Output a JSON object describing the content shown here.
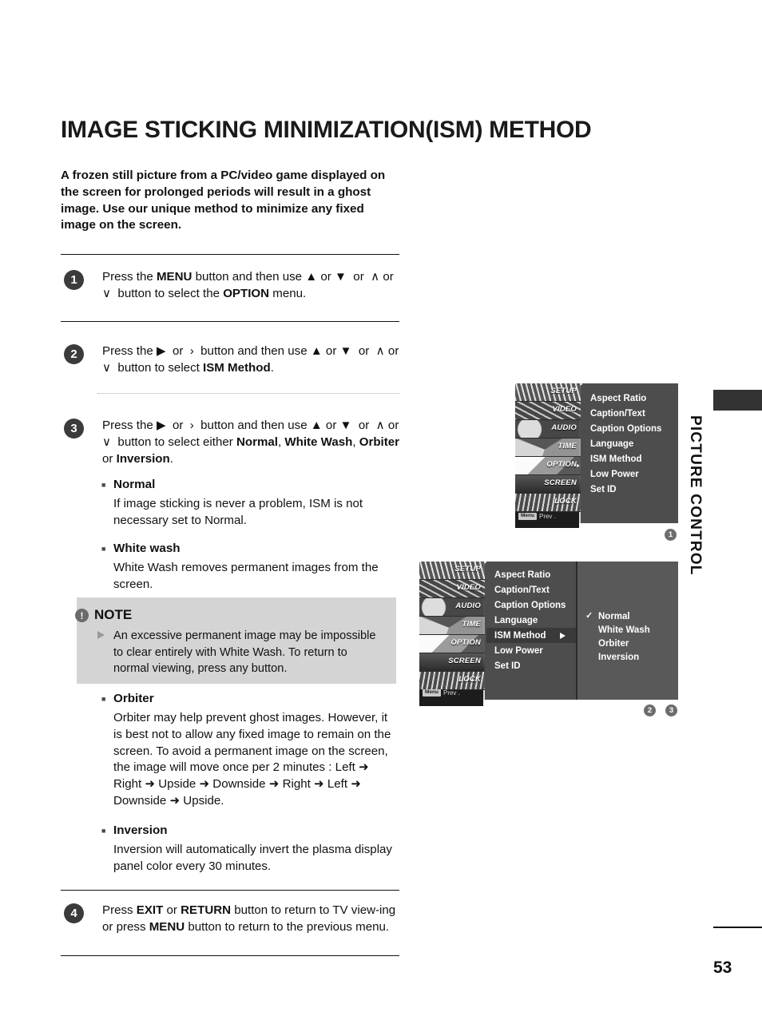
{
  "page": {
    "title": "IMAGE STICKING MINIMIZATION(ISM) METHOD",
    "intro": "A frozen still picture from a PC/video game displayed on the screen for prolonged periods will result in a ghost image. Use our unique method to minimize any fixed image on the screen.",
    "section_tab": "PICTURE CONTROL",
    "number": "53"
  },
  "steps": [
    {
      "num": "1",
      "html": "Press the <b>MENU</b> button and then use ▲ or ▼&nbsp; or &nbsp;∧ or ∨&nbsp; button to select the <b>OPTION</b> menu.",
      "text": "Press the MENU button and then use ▲ or ▼ or ∧ or ∨ button to select the OPTION menu."
    },
    {
      "num": "2",
      "html": "Press the ▶&nbsp; or &nbsp;›&nbsp; button and then use ▲ or ▼&nbsp; or &nbsp;∧ or ∨&nbsp; button to select <b>ISM Method</b>.",
      "text": "Press the ▶ or › button and then use ▲ or ▼ or ∧ or ∨ button to select ISM Method."
    },
    {
      "num": "3",
      "html": "Press the ▶&nbsp; or &nbsp;›&nbsp; button and then use ▲ or ▼&nbsp; or &nbsp;∧ or ∨&nbsp; button to select either <b>Normal</b>, <b>White Wash</b>, <b>Orbiter</b> or <b>Inversion</b>.",
      "text": "Press the ▶ or › button and then use ▲ or ▼ or ∧ or ∨ button to select either Normal, White Wash, Orbiter or Inversion."
    },
    {
      "num": "4",
      "html": "Press <b>EXIT</b> or <b>RETURN</b> button to return to TV view-ing or press <b>MENU</b> button to return to the previous menu.",
      "text": "Press EXIT or RETURN button to return to TV viewing or press MENU button to return to the previous menu."
    }
  ],
  "bullets": [
    {
      "head": "Normal",
      "body": "If image sticking is never a problem, ISM is not necessary set to Normal."
    },
    {
      "head": "White wash",
      "body": "White Wash removes permanent images from the screen."
    },
    {
      "head": "Orbiter",
      "body": "Orbiter may help prevent ghost images. However, it is best not to allow any fixed image to remain on the screen. To avoid a permanent image on the screen, the image will move once per 2 minutes : Left ➜ Right ➜ Upside ➜ Downside ➜ Right ➜ Left ➜ Downside ➜ Upside."
    },
    {
      "head": "Inversion",
      "body": "Inversion will automatically invert the plasma display panel color every 30 minutes."
    }
  ],
  "note": {
    "icon": "!",
    "title": "NOTE",
    "body": "An excessive permanent image may be impossible to clear entirely with White Wash. To return to normal viewing, press any button."
  },
  "tv_menu": {
    "sidebar": [
      {
        "label": "SETUP",
        "selected": false
      },
      {
        "label": "VIDEO",
        "selected": false
      },
      {
        "label": "AUDIO",
        "selected": false
      },
      {
        "label": "TIME",
        "selected": false
      },
      {
        "label": "OPTION",
        "selected": true
      },
      {
        "label": "SCREEN",
        "selected": false
      },
      {
        "label": "LOCK",
        "selected": false
      }
    ],
    "prev_chip": "Menu",
    "prev_label": "Prev .",
    "items": [
      "Aspect Ratio",
      "Caption/Text",
      "Caption Options",
      "Language",
      "ISM Method",
      "Low Power",
      "Set ID"
    ],
    "submenu": [
      {
        "label": "Normal",
        "checked": true
      },
      {
        "label": "White Wash",
        "checked": false
      },
      {
        "label": "Orbiter",
        "checked": false
      },
      {
        "label": "Inversion",
        "checked": false
      }
    ],
    "check_glyph": "✓",
    "markers": {
      "first": "1",
      "second": "2",
      "third": "3"
    }
  }
}
